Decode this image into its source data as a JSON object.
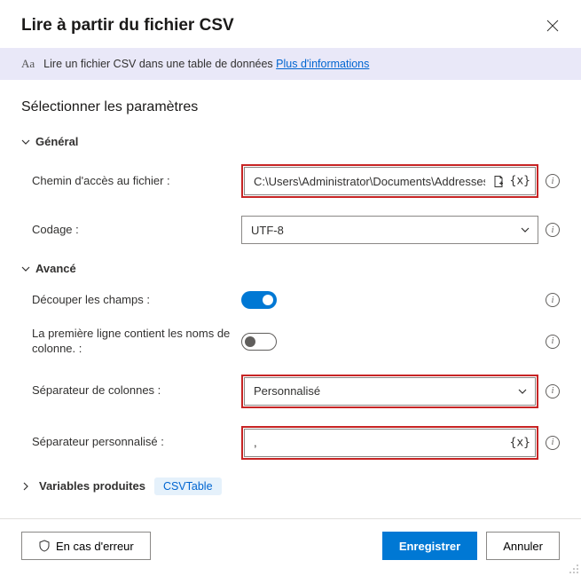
{
  "title": "Lire à partir du fichier CSV",
  "info": {
    "text": "Lire un fichier CSV dans une table de données",
    "link": "Plus d'informations"
  },
  "section_title": "Sélectionner les paramètres",
  "groups": {
    "general": "Général",
    "advanced": "Avancé"
  },
  "fields": {
    "file_path": {
      "label": "Chemin d'accès au fichier :",
      "value": "C:\\Users\\Administrator\\Documents\\Addresses.csv"
    },
    "encoding": {
      "label": "Codage :",
      "value": "UTF-8"
    },
    "trim": {
      "label": "Découper les champs :",
      "value": true
    },
    "first_row": {
      "label": "La première ligne contient les noms de colonne. :",
      "value": false
    },
    "column_sep": {
      "label": "Séparateur de colonnes :",
      "value": "Personnalisé"
    },
    "custom_sep": {
      "label": "Séparateur personnalisé :",
      "value": ","
    }
  },
  "variables": {
    "label": "Variables produites",
    "chip": "CSVTable"
  },
  "footer": {
    "on_error": "En cas d'erreur",
    "save": "Enregistrer",
    "cancel": "Annuler"
  }
}
